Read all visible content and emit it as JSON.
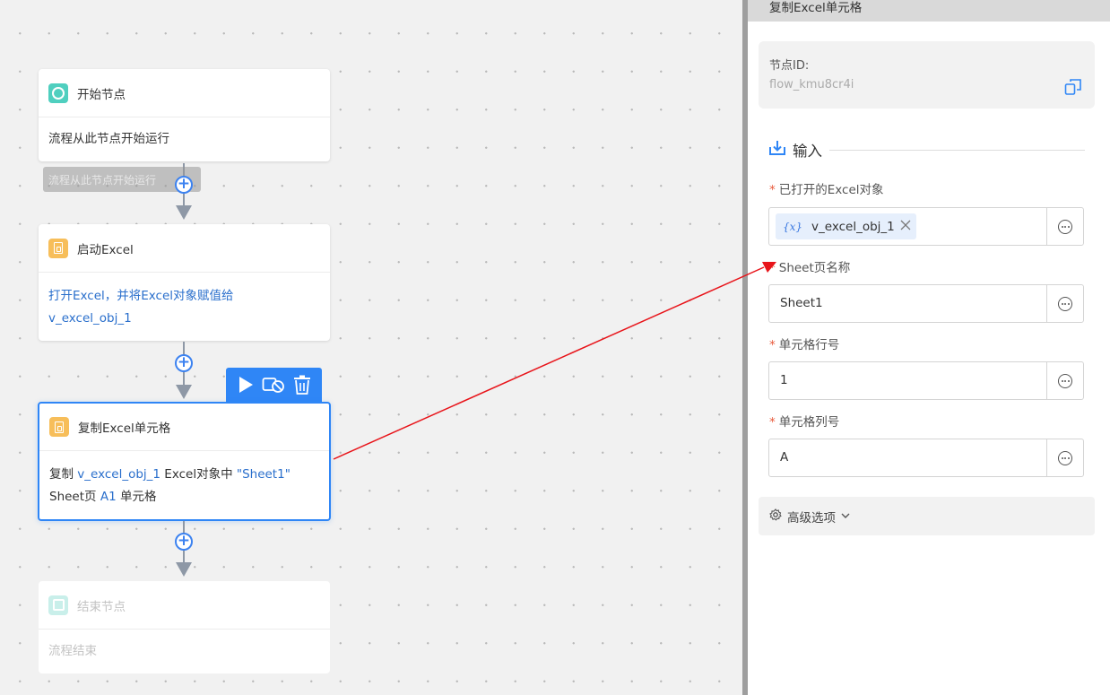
{
  "canvas": {
    "nodes": [
      {
        "type": "start",
        "title": "开始节点",
        "body_plain": "流程从此节点开始运行"
      },
      {
        "type": "excel",
        "title": "启动Excel",
        "body_line1": "打开Excel，并将Excel对象赋值给",
        "body_line2": "v_excel_obj_1"
      },
      {
        "type": "excel",
        "title": "复制Excel单元格",
        "body_parts": {
          "prefix": "复制 ",
          "var": "v_excel_obj_1",
          "mid": " Excel对象中 ",
          "sheet": "\"Sheet1\"",
          "line2_prefix": "Sheet页 ",
          "cell": "A1",
          "suffix": " 单元格"
        }
      },
      {
        "type": "end",
        "title": "结束节点",
        "body_plain": "流程结束"
      }
    ],
    "tooltip": "流程从此节点开始运行",
    "toolbar_icons": [
      "play-icon",
      "disable-icon",
      "delete-icon"
    ]
  },
  "panel": {
    "header": "复制Excel单元格",
    "node_id_label": "节点ID:",
    "node_id_value": "flow_kmu8cr4i",
    "section_input": "输入",
    "fields": [
      {
        "label": "已打开的Excel对象",
        "required": "*",
        "chip_icon": "{x}",
        "chip_value": "v_excel_obj_1"
      },
      {
        "label": "Sheet页名称",
        "required": "*",
        "value": "Sheet1"
      },
      {
        "label": "单元格行号",
        "required": "*",
        "value": "1"
      },
      {
        "label": "单元格列号",
        "required": "*",
        "value": "A"
      }
    ],
    "advanced": "高级选项"
  },
  "colors": {
    "accent": "#2f86f6",
    "start": "#4fcfbf",
    "excel": "#f7be5a",
    "required": "#e85a3c",
    "annotation_arrow": "#e8141a"
  }
}
